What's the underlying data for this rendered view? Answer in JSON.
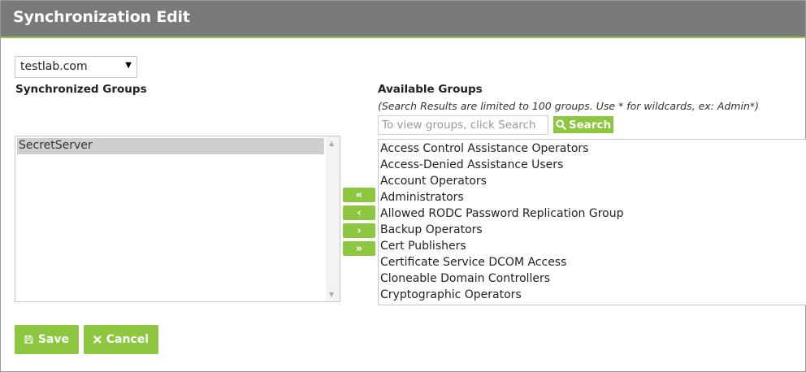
{
  "header": {
    "title": "Synchronization Edit"
  },
  "domain_select": {
    "value": "testlab.com",
    "caret": "▼"
  },
  "synchronized": {
    "title": "Synchronized Groups",
    "items": [
      "SecretServer"
    ]
  },
  "available": {
    "title": "Available Groups",
    "hint": "(Search Results are limited to 100 groups. Use * for wildcards, ex: Admin*)",
    "search_placeholder": "To view groups, click Search",
    "search_button": "Search",
    "items": [
      "Access Control Assistance Operators",
      "Access-Denied Assistance Users",
      "Account Operators",
      "Administrators",
      "Allowed RODC Password Replication Group",
      "Backup Operators",
      "Cert Publishers",
      "Certificate Service DCOM Access",
      "Cloneable Domain Controllers",
      "Cryptographic Operators"
    ]
  },
  "move_buttons": {
    "add_all": "«",
    "add_one": "‹",
    "remove_one": "›",
    "remove_all": "»"
  },
  "actions": {
    "save": "Save",
    "cancel": "Cancel"
  },
  "icons": {
    "search": "search-icon",
    "save": "floppy-disk-icon",
    "cancel": "close-icon"
  },
  "colors": {
    "header_bg": "#7a7a7a",
    "accent": "#8dc63f",
    "selected_row": "#cfcfcf"
  }
}
